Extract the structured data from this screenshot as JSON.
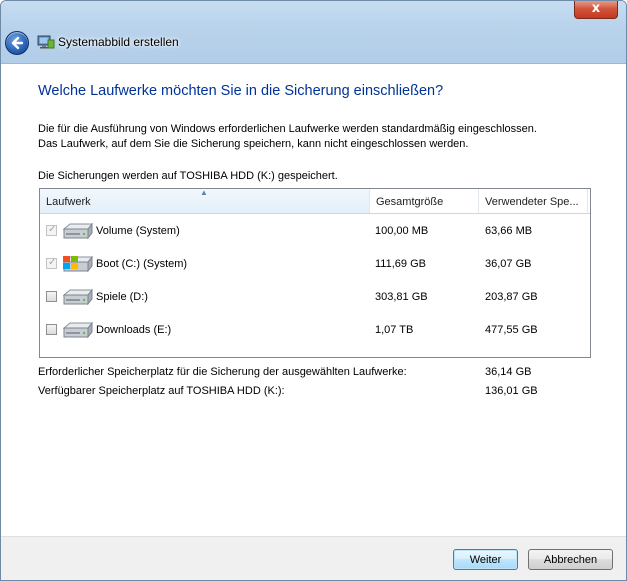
{
  "window": {
    "title": "Systemabbild erstellen",
    "close_label": "x"
  },
  "main": {
    "heading": "Welche Laufwerke möchten Sie in die Sicherung einschließen?",
    "description_line1": "Die für die Ausführung von Windows erforderlichen Laufwerke werden standardmäßig eingeschlossen.",
    "description_line2": "Das Laufwerk, auf dem Sie die Sicherung speichern, kann nicht eingeschlossen werden.",
    "save_info": "Die Sicherungen werden auf TOSHIBA HDD (K:) gespeichert."
  },
  "table": {
    "columns": [
      "Laufwerk",
      "Gesamtgröße",
      "Verwendeter Spe..."
    ],
    "rows": [
      {
        "name": "Volume (System)",
        "total": "100,00 MB",
        "used": "63,66 MB",
        "checked": true,
        "enabled": false,
        "icon": "drive-icon"
      },
      {
        "name": "Boot (C:) (System)",
        "total": "111,69 GB",
        "used": "36,07 GB",
        "checked": true,
        "enabled": false,
        "icon": "windows-drive-icon"
      },
      {
        "name": "Spiele (D:)",
        "total": "303,81 GB",
        "used": "203,87 GB",
        "checked": false,
        "enabled": true,
        "icon": "drive-icon"
      },
      {
        "name": "Downloads (E:)",
        "total": "1,07 TB",
        "used": "477,55 GB",
        "checked": false,
        "enabled": true,
        "icon": "drive-icon"
      }
    ]
  },
  "summary": {
    "required_label": "Erforderlicher Speicherplatz für die Sicherung der ausgewählten Laufwerke:",
    "required_value": "36,14 GB",
    "available_label": "Verfügbarer Speicherplatz auf TOSHIBA HDD (K:):",
    "available_value": "136,01 GB"
  },
  "footer": {
    "next_label": "Weiter",
    "cancel_label": "Abbrechen"
  },
  "colors": {
    "heading": "#003399",
    "titlebar": "#b9d3ec",
    "close": "#c23a20"
  }
}
